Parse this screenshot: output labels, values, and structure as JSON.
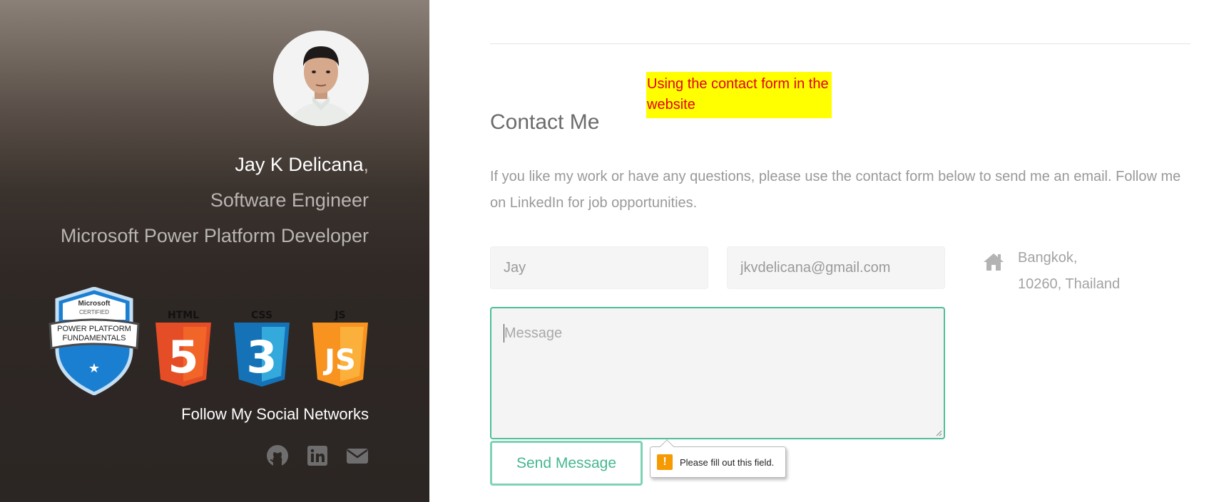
{
  "profile": {
    "name": "Jay K Delicana",
    "name_suffix": ",",
    "role_1": "Software Engineer",
    "role_2": "Microsoft Power Platform Developer",
    "badge": {
      "brand": "Microsoft",
      "certified": "CERTIFIED",
      "line1": "POWER PLATFORM",
      "line2": "FUNDAMENTALS"
    },
    "tech_logos": [
      {
        "label": "HTML",
        "number": "5",
        "color": "#e44d26"
      },
      {
        "label": "CSS",
        "number": "3",
        "color": "#1572b6"
      },
      {
        "label": "JS",
        "number": "JS",
        "color": "#f7931e"
      }
    ],
    "follow_heading": "Follow My Social Networks",
    "socials": [
      "github-icon",
      "linkedin-icon",
      "envelope-icon"
    ]
  },
  "annotation": {
    "text": "Using the contact form in the website"
  },
  "contact": {
    "title": "Contact Me",
    "lead": "If you like my work or have any questions, please use the contact form below to send me an email. Follow me on LinkedIn for job opportunities.",
    "name_value": "Jay",
    "email_value": "jkvdelicana@gmail.com",
    "message_placeholder": "Message",
    "send_label": "Send Message",
    "validation_message": "Please fill out this field.",
    "location_line1": "Bangkok,",
    "location_line2": "10260, Thailand"
  },
  "colors": {
    "accent": "#4dbf97",
    "note_bg": "#ffff00",
    "note_text": "#e0001b"
  }
}
